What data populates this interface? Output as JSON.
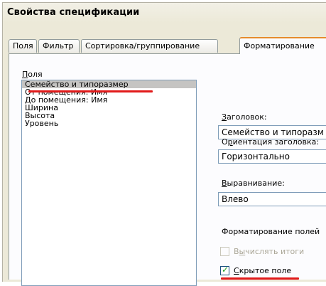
{
  "window": {
    "title": "Свойства спецификации"
  },
  "tabs": [
    {
      "label": "Поля"
    },
    {
      "label": "Фильтр"
    },
    {
      "label": "Сортировка/группирование"
    },
    {
      "label": "Форматирование"
    }
  ],
  "fields_panel": {
    "label_first": "П",
    "label_rest": "оля",
    "items": [
      "Семейство и типоразмер",
      "От помещения: Имя",
      "До помещения: Имя",
      "Ширина",
      "Высота",
      "Уровень"
    ],
    "selected_index": 0
  },
  "heading": {
    "label_first": "З",
    "label_rest": "аголовок:",
    "value": "Семейство и типоразм"
  },
  "orientation": {
    "label_first": "О",
    "label_second": "р",
    "label_rest": "иентация заголовка:",
    "value": "Горизонтально"
  },
  "alignment": {
    "label_first": "В",
    "label_rest": "ыравнивание:",
    "value": "Влево"
  },
  "field_formatting": {
    "label": "Форматирование полей"
  },
  "calc_totals": {
    "label_first": "В",
    "label_second": "ы",
    "label_rest": "числять итоги",
    "checked": false,
    "enabled": false
  },
  "hidden_field": {
    "label_first": "С",
    "label_rest": "крытое поле",
    "checked": true,
    "enabled": true
  },
  "colors": {
    "highlight": "#e11a1a",
    "active_tab_accent": "#e68b2c",
    "check": "#21a121"
  }
}
